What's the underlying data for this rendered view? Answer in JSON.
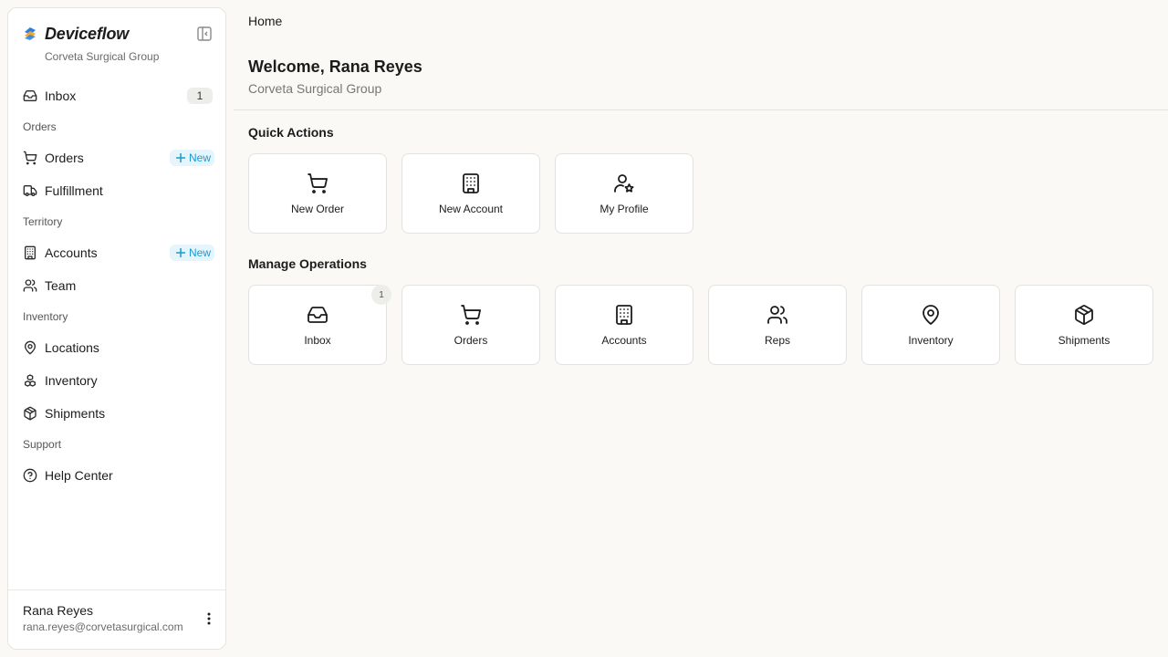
{
  "app": {
    "name": "Deviceflow",
    "org": "Corveta Surgical Group",
    "accent": "#1a9bd7",
    "logo_colors": [
      "#2b7fe0",
      "#f5a623"
    ]
  },
  "sidebar": {
    "inbox": {
      "label": "Inbox",
      "count": "1",
      "icon": "inbox-icon"
    },
    "sections": {
      "orders": "Orders",
      "territory": "Territory",
      "inventory": "Inventory",
      "support": "Support"
    },
    "orders": {
      "label": "Orders",
      "new_label": "New",
      "icon": "cart-icon"
    },
    "fulfillment": {
      "label": "Fulfillment",
      "icon": "truck-icon"
    },
    "accounts": {
      "label": "Accounts",
      "new_label": "New",
      "icon": "building-icon"
    },
    "team": {
      "label": "Team",
      "icon": "users-icon"
    },
    "locations": {
      "label": "Locations",
      "icon": "map-pin-icon"
    },
    "inventory": {
      "label": "Inventory",
      "icon": "boxes-icon"
    },
    "shipments": {
      "label": "Shipments",
      "icon": "package-icon"
    },
    "help": {
      "label": "Help Center",
      "icon": "help-circle-icon"
    }
  },
  "user": {
    "name": "Rana Reyes",
    "email": "rana.reyes@corvetasurgical.com"
  },
  "main": {
    "breadcrumb": "Home",
    "welcome": "Welcome, Rana Reyes",
    "org": "Corveta Surgical Group",
    "quick_actions_title": "Quick Actions",
    "quick_actions": [
      {
        "label": "New Order",
        "icon": "cart-icon"
      },
      {
        "label": "New Account",
        "icon": "building-icon"
      },
      {
        "label": "My Profile",
        "icon": "user-star-icon"
      }
    ],
    "manage_title": "Manage Operations",
    "manage": [
      {
        "label": "Inbox",
        "icon": "inbox-icon",
        "count": "1"
      },
      {
        "label": "Orders",
        "icon": "cart-icon"
      },
      {
        "label": "Accounts",
        "icon": "building-icon"
      },
      {
        "label": "Reps",
        "icon": "users-icon"
      },
      {
        "label": "Inventory",
        "icon": "map-pin-icon"
      },
      {
        "label": "Shipments",
        "icon": "package-icon"
      }
    ]
  }
}
